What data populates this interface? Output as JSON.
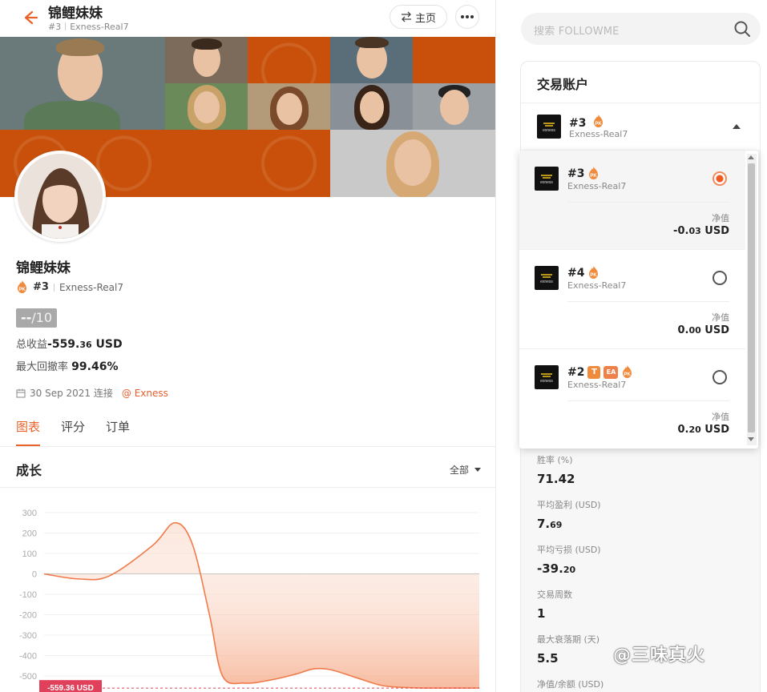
{
  "header": {
    "title": "锦鲤妹妹",
    "account_num": "#3",
    "account_name": "Exness-Real7",
    "home_label": "主页",
    "home_icon": "swap-arrows-icon",
    "more_icon": "ellipsis-icon"
  },
  "profile": {
    "name": "锦鲤妹妹",
    "account_num": "#3",
    "account_name": "Exness-Real7",
    "score_value": "--",
    "score_max": "/10",
    "total_profit_label": "总收益",
    "total_profit_int": "-559.",
    "total_profit_dec": "36",
    "total_profit_unit": " USD",
    "max_drawdown_label": "最大回撤率",
    "max_drawdown_value": "99.46%",
    "connected_date": "30 Sep 2021 连接",
    "broker": "@ Exness"
  },
  "tabs": [
    {
      "label": "图表",
      "active": true
    },
    {
      "label": "评分",
      "active": false
    },
    {
      "label": "订单",
      "active": false
    }
  ],
  "growth": {
    "title": "成长",
    "range_label": "全部"
  },
  "chart_data": {
    "type": "area",
    "title": "成长",
    "y_ticks": [
      "300",
      "200",
      "100",
      "0",
      "-100",
      "-200",
      "-300",
      "-400",
      "-500"
    ],
    "ylim": [
      -560,
      330
    ],
    "x": [
      0,
      0.08,
      0.15,
      0.25,
      0.3,
      0.34,
      0.38,
      0.41,
      0.46,
      0.52,
      0.58,
      0.62,
      0.66,
      0.72,
      0.78,
      0.85,
      0.92,
      1.0
    ],
    "values": [
      0,
      -25,
      -10,
      140,
      250,
      150,
      -200,
      -500,
      -535,
      -520,
      -490,
      -465,
      -470,
      -510,
      -548,
      -558,
      -559,
      -559.36
    ],
    "last_value_label": "-559.36 USD",
    "colors": {
      "line": "#f07a4a",
      "fill": "#f39b72"
    }
  },
  "search": {
    "placeholder": "搜索 FOLLOWME",
    "icon": "search-icon"
  },
  "accounts_card": {
    "title": "交易账户",
    "selected": {
      "num": "#3",
      "sub": "Exness-Real7"
    }
  },
  "dropdown": {
    "items": [
      {
        "num": "#3",
        "sub": "Exness-Real7",
        "badges": [
          "PK"
        ],
        "label": "净值",
        "value_int": "-0.",
        "value_dec": "03",
        "unit": " USD",
        "selected": true
      },
      {
        "num": "#4",
        "sub": "Exness-Real7",
        "badges": [
          "PK"
        ],
        "label": "净值",
        "value_int": "0.",
        "value_dec": "00",
        "unit": " USD",
        "selected": false
      },
      {
        "num": "#2",
        "sub": "Exness-Real7",
        "badges": [
          "T",
          "EA",
          "PK"
        ],
        "label": "净值",
        "value_int": "0.",
        "value_dec": "20",
        "unit": " USD",
        "selected": false
      }
    ]
  },
  "stats": [
    {
      "label": "胜率 (%)",
      "value_int": "71.42",
      "value_dec": ""
    },
    {
      "label": "平均盈利 (USD)",
      "value_int": "7.",
      "value_dec": "69"
    },
    {
      "label": "平均亏损 (USD)",
      "value_int": "-39.",
      "value_dec": "20"
    },
    {
      "label": "交易周数",
      "value_int": "1",
      "value_dec": ""
    },
    {
      "label": "最大衰落期 (天)",
      "value_int": "5.5",
      "value_dec": ""
    },
    {
      "label": "净值/余额 (USD)",
      "value_int": "",
      "value_dec": ""
    }
  ],
  "watermark": "@三味真火",
  "colors": {
    "accent": "#e8622a",
    "banner_orange": "#c8500a"
  }
}
